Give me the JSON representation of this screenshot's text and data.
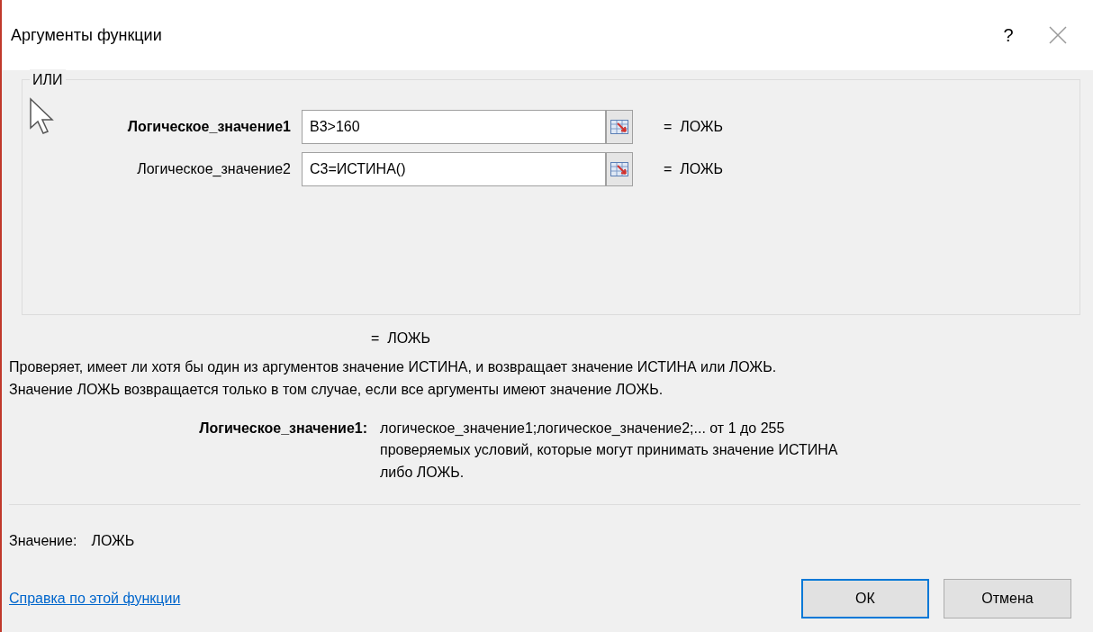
{
  "window": {
    "title": "Аргументы функции",
    "help_button": "?"
  },
  "function_name": "ИЛИ",
  "arguments": [
    {
      "label": "Логическое_значение1",
      "value": "B3>160",
      "result": "=  ЛОЖЬ",
      "active": true
    },
    {
      "label": "Логическое_значение2",
      "value": "C3=ИСТИНА()",
      "result": "=  ЛОЖЬ",
      "active": false
    }
  ],
  "formula_result": "=  ЛОЖЬ",
  "description": "Проверяет, имеет ли хотя бы один из аргументов значение ИСТИНА, и возвращает значение ИСТИНА или ЛОЖЬ. Значение ЛОЖЬ возвращается только в том случае, если все аргументы имеют значение ЛОЖЬ.",
  "argument_help": {
    "label": "Логическое_значение1:",
    "text": "логическое_значение1;логическое_значение2;... от 1 до 255 проверяемых условий, которые могут принимать значение ИСТИНА либо ЛОЖЬ."
  },
  "value": {
    "label": "Значение:",
    "text": "ЛОЖЬ"
  },
  "help_link": "Справка по этой функции",
  "buttons": [
    {
      "label": "ОК",
      "default": true
    },
    {
      "label": "Отмена",
      "default": false
    }
  ]
}
